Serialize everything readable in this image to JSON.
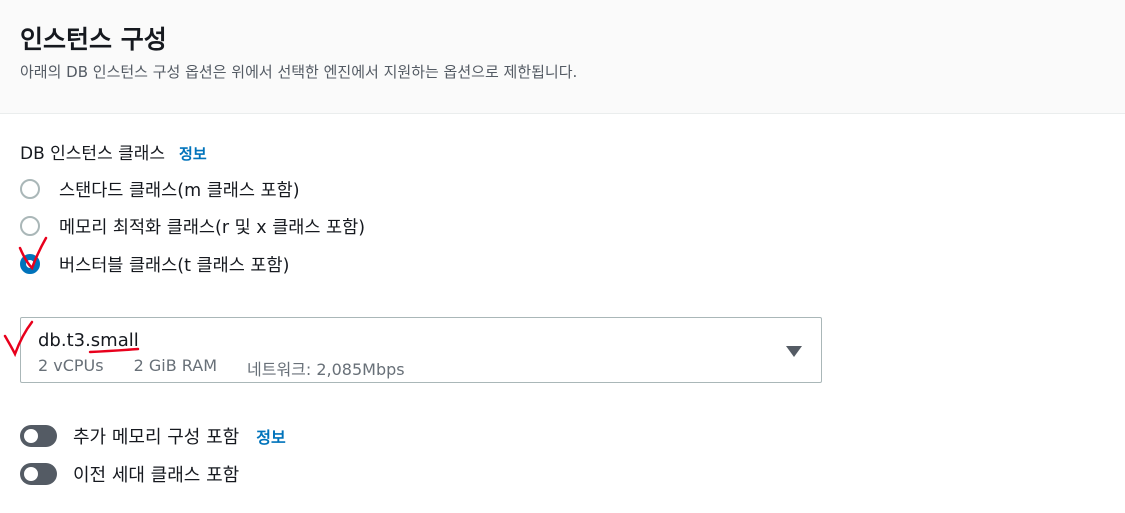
{
  "header": {
    "title": "인스턴스 구성",
    "description": "아래의 DB 인스턴스 구성 옵션은 위에서 선택한 엔진에서 지원하는 옵션으로 제한됩니다."
  },
  "instance_class": {
    "label": "DB 인스턴스 클래스",
    "info_link": "정보",
    "options": [
      {
        "label": "스탠다드 클래스(m 클래스 포함)",
        "selected": false
      },
      {
        "label": "메모리 최적화 클래스(r 및 x 클래스 포함)",
        "selected": false
      },
      {
        "label": "버스터블 클래스(t 클래스 포함)",
        "selected": true
      }
    ]
  },
  "instance_select": {
    "value": "db.t3.small",
    "vcpus": "2 vCPUs",
    "ram": "2 GiB RAM",
    "network": "네트워크: 2,085Mbps"
  },
  "toggles": [
    {
      "label": "추가 메모리 구성 포함",
      "info_link": "정보",
      "enabled": false
    },
    {
      "label": "이전 세대 클래스 포함",
      "enabled": false
    }
  ],
  "colors": {
    "accent": "#0073bb",
    "annotation": "#e8001c",
    "toggle_off": "#545b64"
  }
}
